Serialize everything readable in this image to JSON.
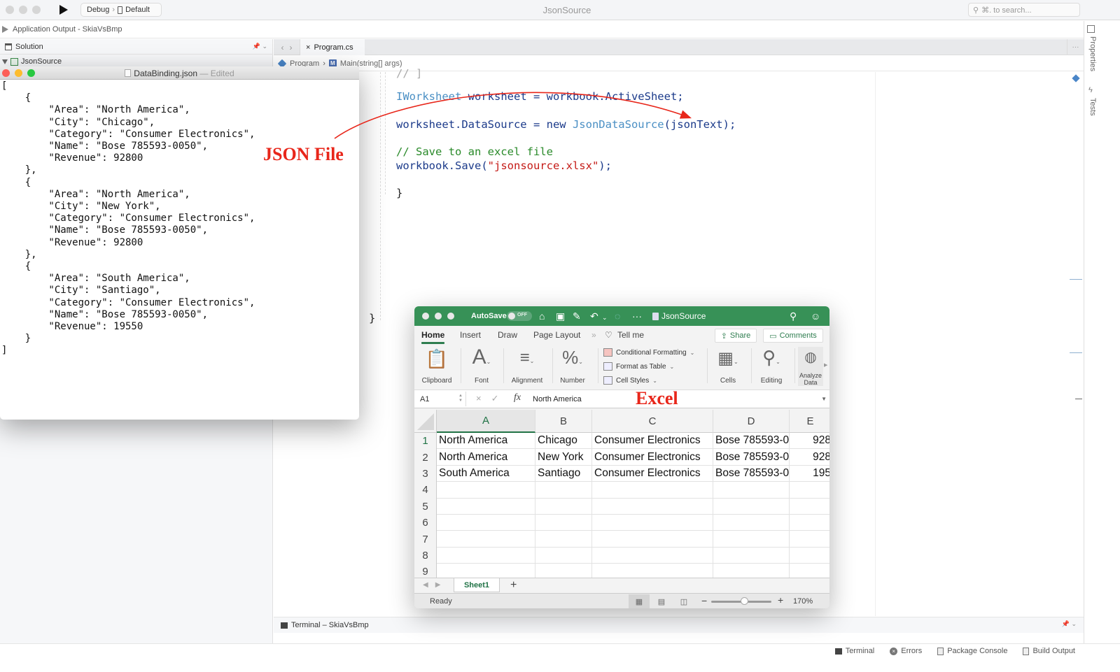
{
  "ide": {
    "title": "JsonSource",
    "run_config": "Debug",
    "run_target": "Default",
    "search_placeholder": "⌘. to search...",
    "app_output_label": "Application Output - SkiaVsBmp",
    "solution_pad_title": "Solution",
    "solution_root": "JsonSource",
    "editor_tab": "Program.cs",
    "breadcrumb": [
      "Program",
      "Main(string[] args)"
    ],
    "right_pads": [
      "Properties",
      "Tests"
    ],
    "terminal_title": "Terminal – SkiaVsBmp",
    "status_items": [
      "Terminal",
      "Errors",
      "Package Console",
      "Build Output"
    ],
    "code_lines": {
      "line1_type": "IWorksheet",
      "line1_rest": " worksheet = workbook.ActiveSheet;",
      "line2_a": "worksheet.DataSource = ",
      "line2_kw": "new",
      "line2_type": " JsonDataSource",
      "line2_rest": "(jsonText);",
      "line3_comment": "// Save to an excel file",
      "line4_a": "workbook.Save(",
      "line4_str": "\"jsonsource.xlsx\"",
      "line4_rest": ");",
      "brace_inner": "}",
      "brace_outer": "}",
      "partial_top": "// ]"
    }
  },
  "json_window": {
    "filename": "DataBinding.json",
    "status": "— Edited",
    "content": "[\n    {\n        \"Area\": \"North America\",\n        \"City\": \"Chicago\",\n        \"Category\": \"Consumer Electronics\",\n        \"Name\": \"Bose 785593-0050\",\n        \"Revenue\": 92800\n    },\n    {\n        \"Area\": \"North America\",\n        \"City\": \"New York\",\n        \"Category\": \"Consumer Electronics\",\n        \"Name\": \"Bose 785593-0050\",\n        \"Revenue\": 92800\n    },\n    {\n        \"Area\": \"South America\",\n        \"City\": \"Santiago\",\n        \"Category\": \"Consumer Electronics\",\n        \"Name\": \"Bose 785593-0050\",\n        \"Revenue\": 19550\n    }\n]",
    "records": [
      {
        "Area": "North America",
        "City": "Chicago",
        "Category": "Consumer Electronics",
        "Name": "Bose 785593-0050",
        "Revenue": 92800
      },
      {
        "Area": "North America",
        "City": "New York",
        "Category": "Consumer Electronics",
        "Name": "Bose 785593-0050",
        "Revenue": 92800
      },
      {
        "Area": "South America",
        "City": "Santiago",
        "Category": "Consumer Electronics",
        "Name": "Bose 785593-0050",
        "Revenue": 19550
      }
    ]
  },
  "annotations": {
    "json_label": "JSON File",
    "excel_label": "Excel",
    "arrow_color": "#e8261a"
  },
  "excel": {
    "autosave_label": "AutoSave",
    "autosave_state": "OFF",
    "doc_name": "JsonSource",
    "tabs": [
      "Home",
      "Insert",
      "Draw",
      "Page Layout",
      "Tell me"
    ],
    "active_tab": "Home",
    "share_label": "Share",
    "comments_label": "Comments",
    "ribbon_groups": [
      "Clipboard",
      "Font",
      "Alignment",
      "Number",
      "Cells",
      "Editing",
      "Analyze Data"
    ],
    "styles_items": [
      "Conditional Formatting",
      "Format as Table",
      "Cell Styles"
    ],
    "name_box": "A1",
    "formula_value": "North America",
    "columns": [
      "A",
      "B",
      "C",
      "D",
      "E"
    ],
    "row_numbers": [
      "1",
      "2",
      "3",
      "4",
      "5",
      "6",
      "7",
      "8",
      "9"
    ],
    "rows": [
      [
        "North America",
        "Chicago",
        "Consumer Electronics",
        "Bose 785593-0",
        "928"
      ],
      [
        "North America",
        "New York",
        "Consumer Electronics",
        "Bose 785593-0",
        "928"
      ],
      [
        "South America",
        "Santiago",
        "Consumer Electronics",
        "Bose 785593-0",
        "195"
      ]
    ],
    "sheet_tab": "Sheet1",
    "status": "Ready",
    "zoom_level": "170%",
    "zoom_fraction": 0.55,
    "brand_color": "#379157"
  }
}
